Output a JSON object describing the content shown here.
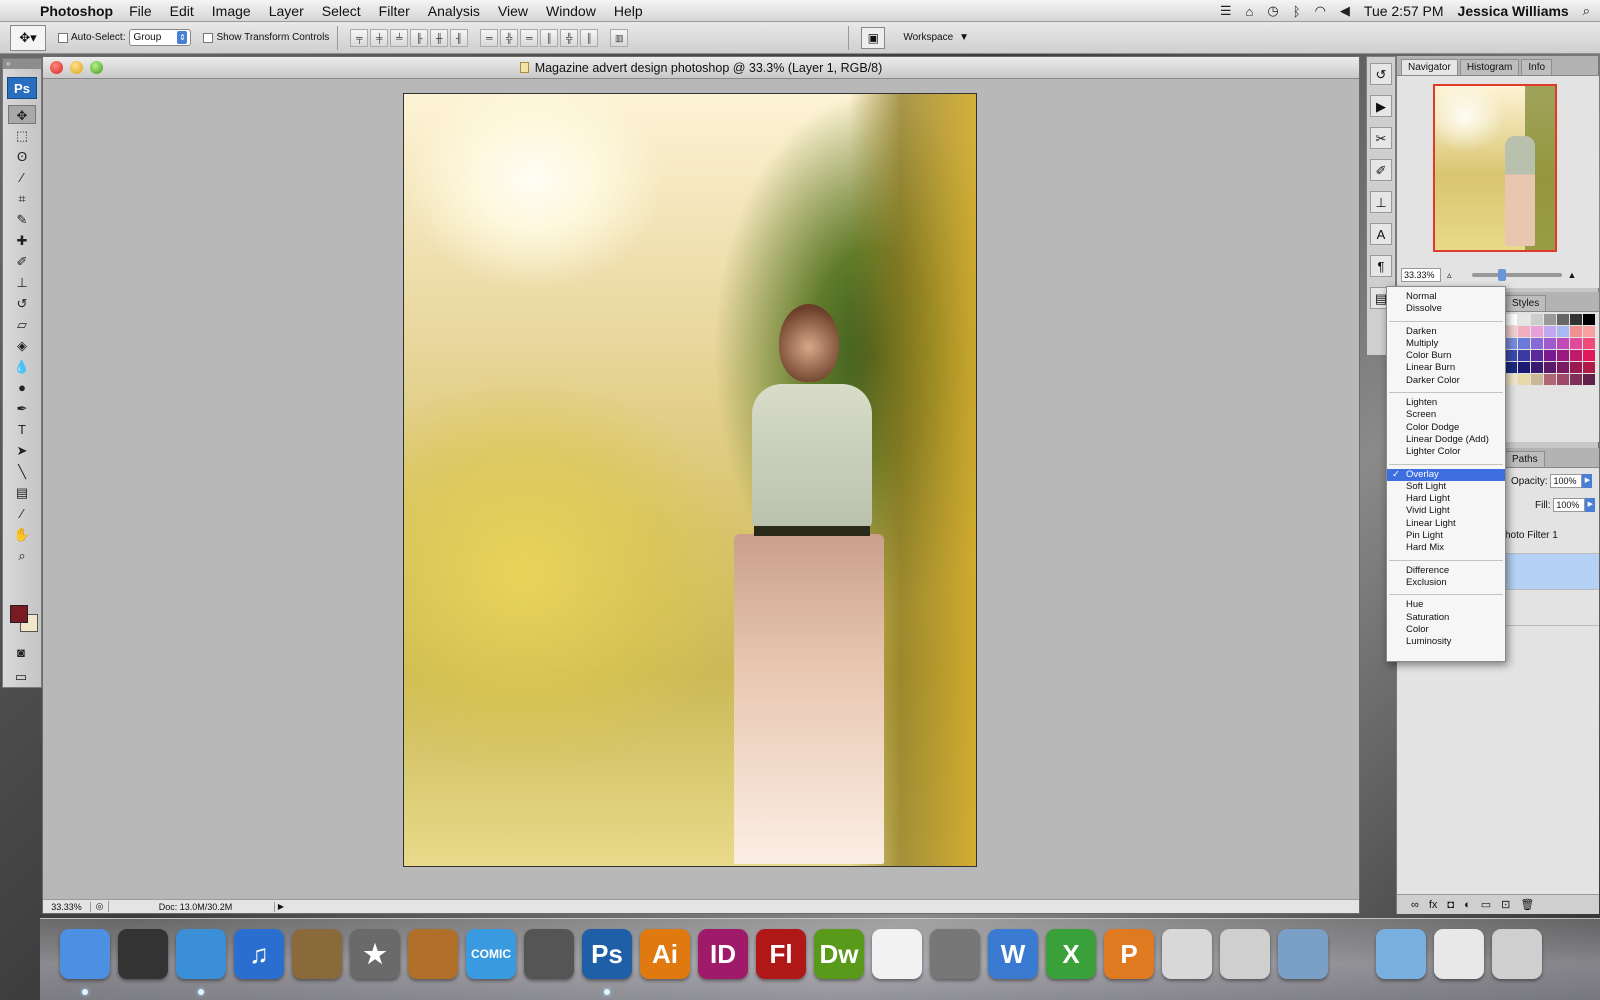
{
  "menubar": {
    "app_name": "Photoshop",
    "menus": [
      "File",
      "Edit",
      "Image",
      "Layer",
      "Select",
      "Filter",
      "Analysis",
      "View",
      "Window",
      "Help"
    ],
    "clock": "Tue 2:57 PM",
    "user": "Jessica Williams"
  },
  "options_bar": {
    "auto_select_label": "Auto-Select:",
    "auto_select_checked": false,
    "auto_select_value": "Group",
    "show_transform_label": "Show Transform Controls",
    "show_transform_checked": false,
    "workspace_label": "Workspace"
  },
  "toolbox": {
    "logo": "Ps",
    "foreground_color": "#7a1a24",
    "background_color": "#f1e6c8"
  },
  "document": {
    "title": "Magazine advert design photoshop @ 33.3% (Layer 1, RGB/8)",
    "status_zoom": "33.33%",
    "status_doc": "Doc: 13.0M/30.2M"
  },
  "panels": {
    "navigator_tabs": [
      "Navigator",
      "Histogram",
      "Info"
    ],
    "navigator_active_tab": "Navigator",
    "navigator_zoom": "33.33%",
    "swatches_tab": "Styles",
    "layers_tab": "Paths",
    "opacity_label": "Opacity:",
    "opacity_value": "100%",
    "fill_label": "Fill:",
    "fill_value": "100%",
    "layer_partial_name": "hoto Filter 1"
  },
  "blend_menu": {
    "groups": [
      [
        "Normal",
        "Dissolve"
      ],
      [
        "Darken",
        "Multiply",
        "Color Burn",
        "Linear Burn",
        "Darker Color"
      ],
      [
        "Lighten",
        "Screen",
        "Color Dodge",
        "Linear Dodge (Add)",
        "Lighter Color"
      ],
      [
        "Overlay",
        "Soft Light",
        "Hard Light",
        "Vivid Light",
        "Linear Light",
        "Pin Light",
        "Hard Mix"
      ],
      [
        "Difference",
        "Exclusion"
      ],
      [
        "Hue",
        "Saturation",
        "Color",
        "Luminosity"
      ]
    ],
    "selected": "Overlay",
    "check_mark": "✓"
  },
  "dock": {
    "apps": [
      {
        "name": "finder",
        "label": "",
        "color": "#4d8fe0"
      },
      {
        "name": "dashboard",
        "label": "",
        "color": "#333333"
      },
      {
        "name": "safari",
        "label": "",
        "color": "#3a8fd6"
      },
      {
        "name": "itunes",
        "label": "♫",
        "color": "#2a6fd0"
      },
      {
        "name": "iphoto",
        "label": "",
        "color": "#8a6a3a"
      },
      {
        "name": "imovie",
        "label": "★",
        "color": "#6a6a6a"
      },
      {
        "name": "garageband",
        "label": "",
        "color": "#b0702a"
      },
      {
        "name": "comic-life",
        "label": "COMIC",
        "color": "#3a9ae0"
      },
      {
        "name": "photo-booth",
        "label": "",
        "color": "#555555"
      },
      {
        "name": "photoshop",
        "label": "Ps",
        "color": "#1f5fa8"
      },
      {
        "name": "illustrator",
        "label": "Ai",
        "color": "#e07a10"
      },
      {
        "name": "indesign",
        "label": "ID",
        "color": "#a01a6a"
      },
      {
        "name": "flash",
        "label": "Fl",
        "color": "#b01818"
      },
      {
        "name": "dreamweaver",
        "label": "Dw",
        "color": "#5a9a1a"
      },
      {
        "name": "acrobat",
        "label": "",
        "color": "#f2f2f2"
      },
      {
        "name": "system-preferences",
        "label": "",
        "color": "#777777"
      },
      {
        "name": "word",
        "label": "W",
        "color": "#3a7ad0"
      },
      {
        "name": "excel",
        "label": "X",
        "color": "#3aa03a"
      },
      {
        "name": "powerpoint",
        "label": "P",
        "color": "#e07a20"
      },
      {
        "name": "preview",
        "label": "",
        "color": "#d8d8d8"
      },
      {
        "name": "scissors",
        "label": "",
        "color": "#cfcfcf"
      },
      {
        "name": "iphoto-2",
        "label": "",
        "color": "#7aa0c8"
      },
      {
        "name": "applications-folder",
        "label": "",
        "color": "#7ab0e0"
      },
      {
        "name": "documents",
        "label": "",
        "color": "#e8e8e8"
      },
      {
        "name": "trash",
        "label": "",
        "color": "#cfcfcf"
      }
    ]
  }
}
